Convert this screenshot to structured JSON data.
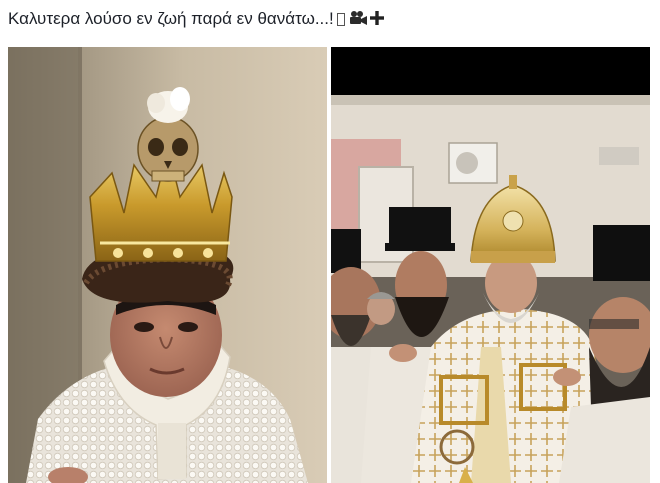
{
  "post": {
    "caption": "Καλυτερα λούσο εν ζωή παρά εν θανάτω...!",
    "caption_icons": [
      "missing-glyph-box",
      "movie-camera-icon",
      "cross-icon"
    ]
  },
  "photos": [
    {
      "name": "left-photo"
    },
    {
      "name": "right-photo"
    }
  ]
}
